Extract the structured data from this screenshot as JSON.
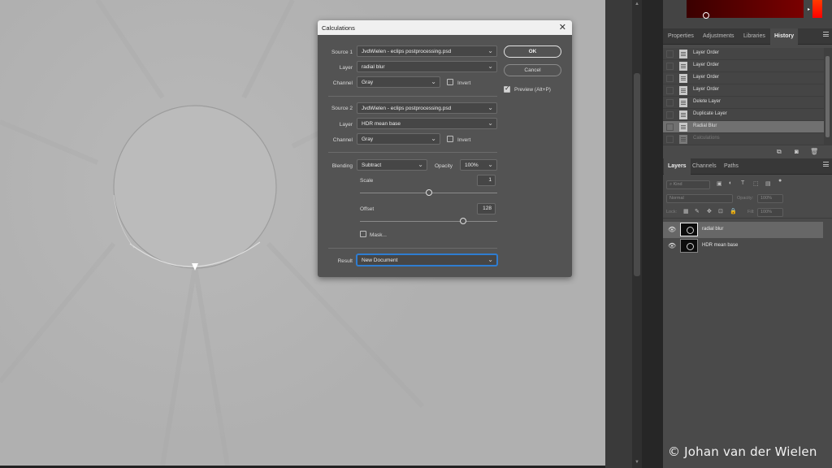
{
  "dialog": {
    "title": "Calculations",
    "close_icon": "close-icon",
    "source1": {
      "label": "Source 1",
      "value": "JvdWielen - eclips postprocessing.psd"
    },
    "layer1": {
      "label": "Layer",
      "value": "radial blur"
    },
    "channel1": {
      "label": "Channel",
      "value": "Gray",
      "invert_label": "Invert",
      "invert_checked": false
    },
    "source2": {
      "label": "Source 2",
      "value": "JvdWielen - eclips postprocessing.psd"
    },
    "layer2": {
      "label": "Layer",
      "value": "HDR mean base"
    },
    "channel2": {
      "label": "Channel",
      "value": "Gray",
      "invert_label": "Invert",
      "invert_checked": false
    },
    "blending": {
      "label": "Blending",
      "value": "Subtract",
      "opacity_label": "Opacity",
      "opacity_value": "100%"
    },
    "scale": {
      "label": "Scale",
      "value": "1",
      "slider_fraction": 0.5
    },
    "offset": {
      "label": "Offset",
      "value": "128",
      "slider_fraction": 0.75
    },
    "mask": {
      "label": "Mask...",
      "checked": false
    },
    "result": {
      "label": "Result",
      "value": "New Document"
    },
    "ok_label": "OK",
    "cancel_label": "Cancel",
    "preview": {
      "label": "Preview (Alt+P)",
      "checked": true
    }
  },
  "panel_top": {
    "tabs": [
      "Properties",
      "Adjustments",
      "Libraries",
      "History"
    ],
    "active_tab": "History"
  },
  "history": {
    "items": [
      {
        "label": "Layer Order"
      },
      {
        "label": "Layer Order"
      },
      {
        "label": "Layer Order"
      },
      {
        "label": "Layer Order"
      },
      {
        "label": "Delete Layer"
      },
      {
        "label": "Duplicate Layer"
      },
      {
        "label": "Radial Blur",
        "selected": true
      },
      {
        "label": "Calculations",
        "dimmed": true
      }
    ]
  },
  "panel_bottom": {
    "tabs": [
      "Layers",
      "Channels",
      "Paths"
    ],
    "active_tab": "Layers",
    "filter_placeholder": "Kind",
    "blend_mode": "Normal",
    "opacity_label": "Opacity:",
    "opacity_value": "100%",
    "lock_label": "Lock:",
    "fill_label": "Fill:",
    "fill_value": "100%"
  },
  "layers": [
    {
      "name": "radial blur",
      "selected": true,
      "visible": true
    },
    {
      "name": "HDR mean base",
      "selected": false,
      "visible": true
    }
  ],
  "copyright": "© Johan van der Wielen",
  "colors": {
    "canvas_bg": "#b4b4b4",
    "dialog_bg": "#535353",
    "accent_focus": "#2f7dd1",
    "hue_marker": "#ff0000"
  }
}
